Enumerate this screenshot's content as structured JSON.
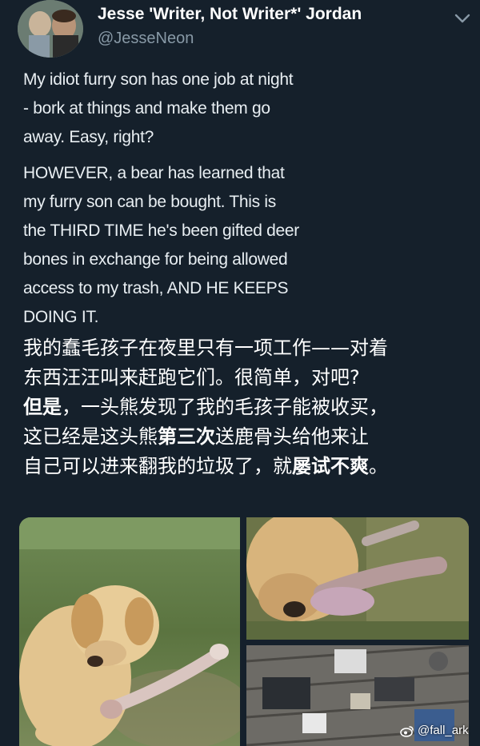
{
  "tweet": {
    "author": {
      "display_name": "Jesse 'Writer, Not Writer*' Jordan",
      "handle": "@JesseNeon"
    },
    "menu_icon": "chevron-down-icon",
    "text_en": {
      "paragraph1": [
        "My idiot furry son has one job at night",
        "- bork at things and make them go",
        "away. Easy, right?"
      ],
      "paragraph2": [
        "HOWEVER, a bear has learned that",
        "my furry son can be bought. This is",
        "the THIRD TIME he's been gifted deer",
        "bones in exchange for being allowed",
        "access to my trash, AND HE KEEPS",
        "DOING IT."
      ]
    },
    "text_zh": {
      "line1": "我的蠢毛孩子在夜里只有一项工作——对着",
      "line2": "东西汪汪叫来赶跑它们。很简单，对吧?",
      "line3_bold": "但是",
      "line3_rest": "，一头熊发现了我的毛孩子能被收买，",
      "line4_pre": "这已经是这头熊",
      "line4_bold": "第三次",
      "line4_post": "送鹿骨头给他来让",
      "line5_pre": "自己可以进来翻我的垃圾了，就",
      "line5_bold": "屡试不爽",
      "line5_post": "。"
    },
    "photos": [
      {
        "name": "dog-with-bone-on-grass"
      },
      {
        "name": "dog-chewing-deer-bone"
      },
      {
        "name": "trash-on-deck"
      }
    ]
  },
  "watermark": {
    "icon": "weibo-icon",
    "text": "@fall_ark"
  },
  "colors": {
    "background": "#15202b",
    "secondary_text": "#8899a6",
    "primary_text": "#ffffff"
  }
}
